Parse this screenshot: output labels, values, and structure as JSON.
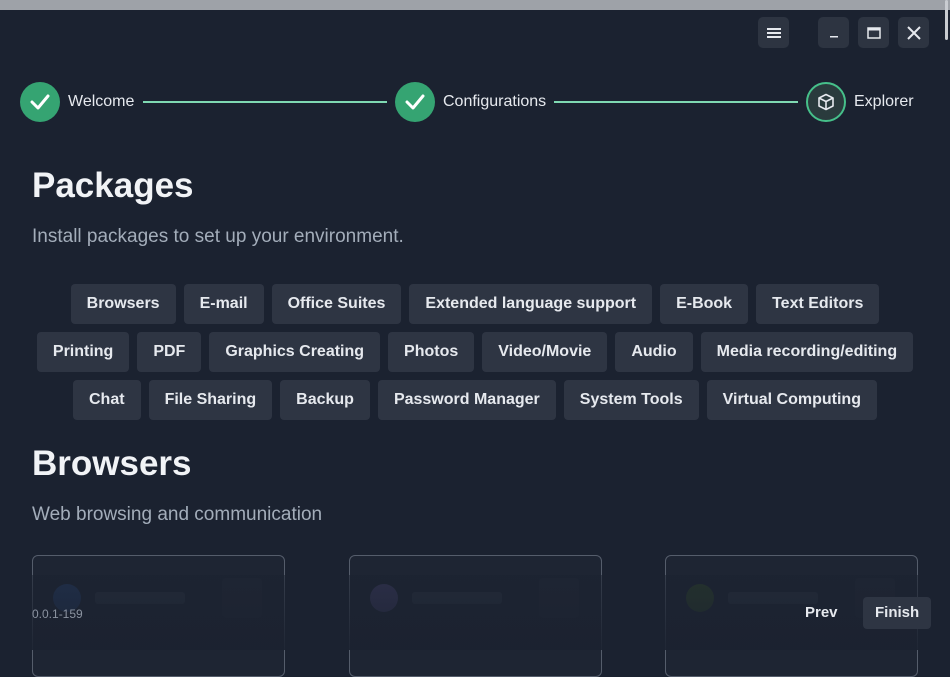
{
  "window": {
    "menu_icon": "hamburger-icon",
    "minimize_icon": "minimize-icon",
    "maximize_icon": "maximize-icon",
    "close_icon": "close-icon"
  },
  "steps": [
    {
      "label": "Welcome",
      "status": "done",
      "icon": "check-icon"
    },
    {
      "label": "Configurations",
      "status": "done",
      "icon": "check-icon"
    },
    {
      "label": "Explorer",
      "status": "current",
      "icon": "package-box-icon"
    }
  ],
  "packages": {
    "title": "Packages",
    "subtitle": "Install packages to set up your environment.",
    "categories": [
      [
        "Browsers",
        "E-mail",
        "Office Suites",
        "Extended language support",
        "E-Book",
        "Text Editors"
      ],
      [
        "Printing",
        "PDF",
        "Graphics Creating",
        "Photos",
        "Video/Movie",
        "Audio",
        "Media recording/editing"
      ],
      [
        "Chat",
        "File Sharing",
        "Backup",
        "Password Manager",
        "System Tools",
        "Virtual Computing"
      ]
    ]
  },
  "browsers": {
    "title": "Browsers",
    "subtitle": "Web browsing and communication"
  },
  "footer": {
    "version": "0.0.1-159",
    "prev_label": "Prev",
    "finish_label": "Finish"
  },
  "colors": {
    "background": "#1b2230",
    "accent_green": "#35a472",
    "step_line": "#7fd9b2",
    "button_bg": "#2e3543"
  }
}
